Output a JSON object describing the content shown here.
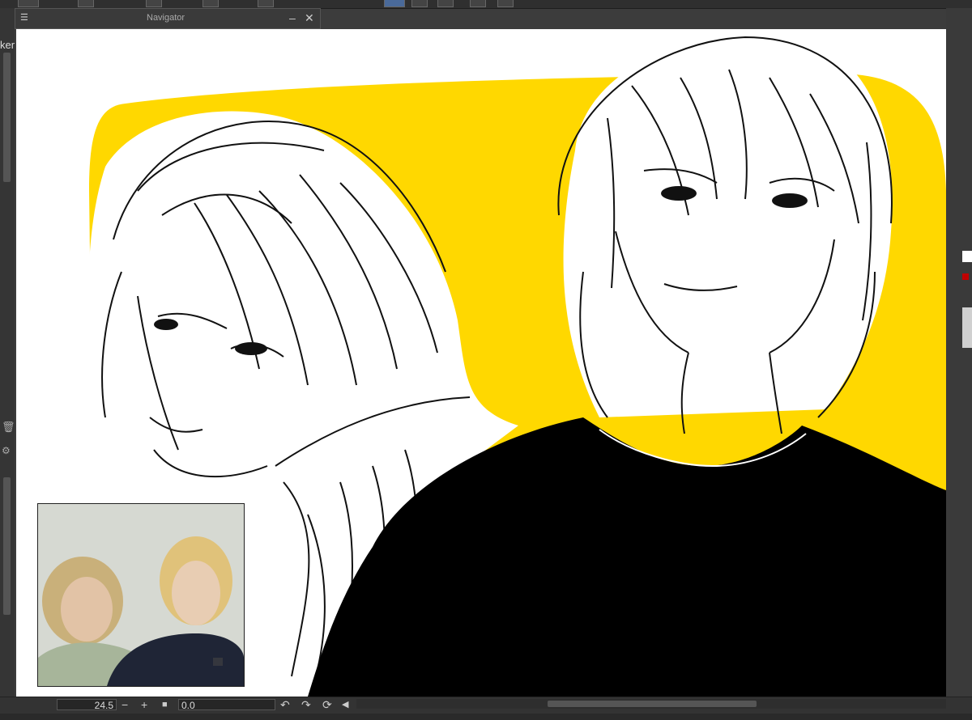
{
  "navigator": {
    "title": "Navigator",
    "menu_icon": "hamburger-icon",
    "minimize_icon": "minimize-icon",
    "close_icon": "close-icon"
  },
  "left_panel": {
    "partial_label": "ker"
  },
  "status_bar": {
    "zoom_value": "24.5",
    "zoom_out_symbol": "−",
    "zoom_in_symbol": "+",
    "rotation_value": "0.0"
  },
  "colors": {
    "canvas_bg": "#ffffff",
    "accent_yellow": "#ffd800",
    "ui_dark": "#3c3c3c",
    "swatch_red": "#c00000"
  }
}
